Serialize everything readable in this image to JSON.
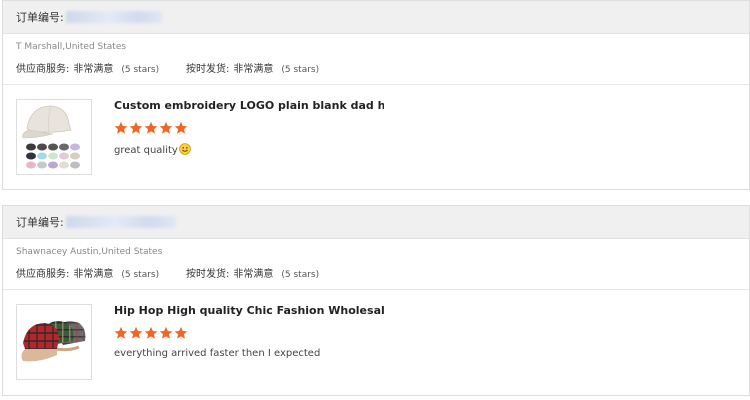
{
  "colors": {
    "star": "#f26522",
    "header_bg": "#f0f0f0",
    "border": "#dddddd"
  },
  "reviews": [
    {
      "order_label": "订单编号:",
      "buyer": "T Marshall,United States",
      "supplier_service": {
        "label": "供应商服务:",
        "value": "非常满意",
        "stars_text": "(5 stars)"
      },
      "on_time_shipping": {
        "label": "按时发货:",
        "value": "非常满意",
        "stars_text": "(5 stars)"
      },
      "product_title": "Custom embroidery LOGO plain blank dad hat ...",
      "rating": 5,
      "comment": "great quality",
      "emoji": "smiley-icon",
      "thumbnail": "white-baseball-caps-icon"
    },
    {
      "order_label": "订单编号:",
      "buyer": "Shawnacey Austin,United States",
      "supplier_service": {
        "label": "供应商服务:",
        "value": "非常满意",
        "stars_text": "(5 stars)"
      },
      "on_time_shipping": {
        "label": "按时发货:",
        "value": "非常满意",
        "stars_text": "(5 stars)"
      },
      "product_title": "Hip Hop High quality Chic Fashion Wholesale U...",
      "rating": 5,
      "comment": "everything arrived faster then I expected",
      "thumbnail": "plaid-caps-icon"
    }
  ]
}
